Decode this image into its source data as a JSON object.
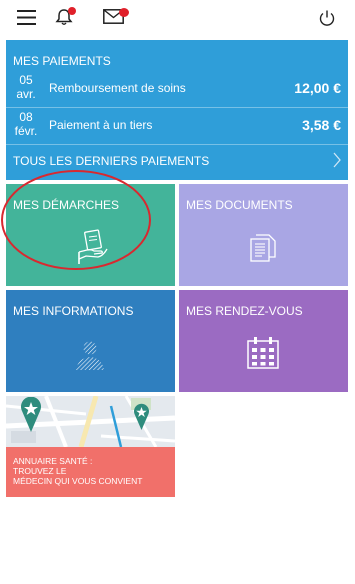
{
  "header": {
    "icons": [
      "menu-icon",
      "bell-icon",
      "mail-icon",
      "power-icon"
    ],
    "badge_color": "#e0202a"
  },
  "payments": {
    "title": "MES PAIEMENTS",
    "items": [
      {
        "day": "05",
        "month": "avr.",
        "label": "Remboursement de soins",
        "amount": "12,00 €"
      },
      {
        "day": "08",
        "month": "févr.",
        "label": "Paiement à un tiers",
        "amount": "3,58 €"
      }
    ],
    "all_link": "TOUS LES DERNIERS PAIEMENTS",
    "color": "#2f9ed9"
  },
  "tiles": {
    "demarches": {
      "label": "MES DÉMARCHES",
      "color": "#43b49a",
      "icon": "hand-document-icon"
    },
    "documents": {
      "label": "MES DOCUMENTS",
      "color": "#a9a6e4",
      "icon": "documents-icon"
    },
    "informations": {
      "label": "MES INFORMATIONS",
      "color": "#2f7fbf",
      "icon": "person-icon"
    },
    "rendezvous": {
      "label": "MES RENDEZ-VOUS",
      "color": "#9b6bc2",
      "icon": "calendar-icon"
    }
  },
  "annuaire": {
    "line1": "ANNUAIRE SANTÉ :",
    "line2": "TROUVEZ LE",
    "line3": "MÉDECIN QUI VOUS CONVIENT",
    "color": "#f1706a",
    "icon": "map-pin-icon"
  },
  "annotation_color": "#d9282f"
}
